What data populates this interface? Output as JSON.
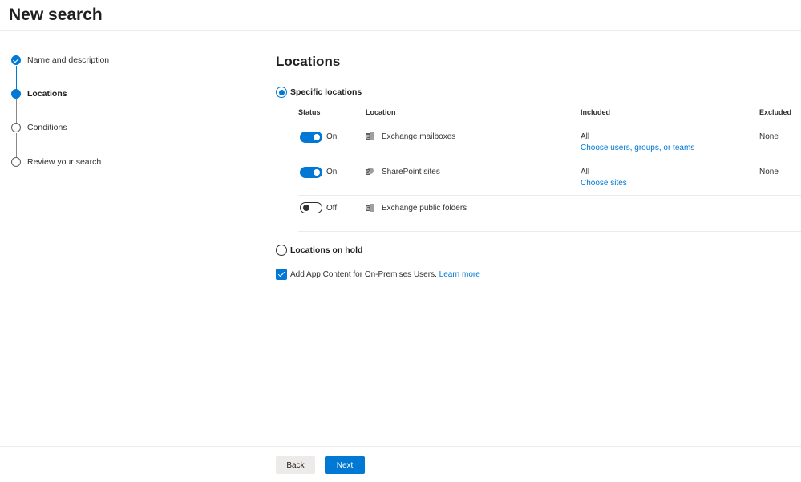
{
  "header": {
    "title": "New search"
  },
  "stepper": {
    "steps": [
      {
        "label": "Name and description",
        "state": "done"
      },
      {
        "label": "Locations",
        "state": "current"
      },
      {
        "label": "Conditions",
        "state": "todo"
      },
      {
        "label": "Review your search",
        "state": "todo"
      }
    ]
  },
  "main": {
    "title": "Locations",
    "specific_option": {
      "label": "Specific locations",
      "selected": true
    },
    "table": {
      "headers": {
        "status": "Status",
        "location": "Location",
        "included": "Included",
        "excluded": "Excluded"
      },
      "rows": [
        {
          "status": "On",
          "enabled": true,
          "icon": "exchange-icon",
          "location": "Exchange mailboxes",
          "included": "All",
          "included_link": "Choose users, groups, or teams",
          "excluded": "None"
        },
        {
          "status": "On",
          "enabled": true,
          "icon": "sharepoint-icon",
          "location": "SharePoint sites",
          "included": "All",
          "included_link": "Choose sites",
          "excluded": "None"
        },
        {
          "status": "Off",
          "enabled": false,
          "icon": "exchange-icon",
          "location": "Exchange public folders",
          "included": "",
          "included_link": "",
          "excluded": ""
        }
      ]
    },
    "hold_option": {
      "label": "Locations on hold",
      "selected": false
    },
    "app_content": {
      "label": "Add App Content for On-Premises Users.",
      "link": "Learn more",
      "checked": true
    }
  },
  "footer": {
    "back_label": "Back",
    "next_label": "Next"
  },
  "colors": {
    "accent": "#0078d4",
    "text": "#323130",
    "divider": "#edebe9",
    "secondary_button": "#edebe9"
  }
}
